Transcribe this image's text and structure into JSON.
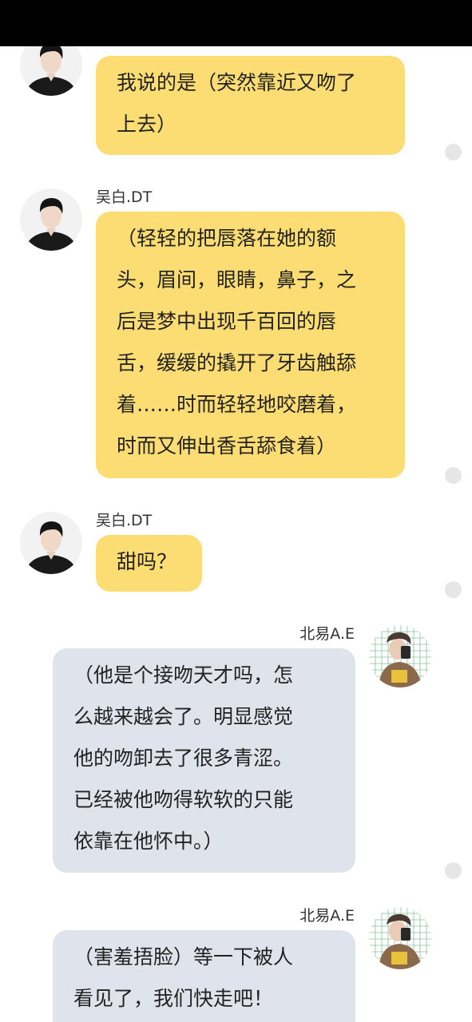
{
  "status_bar": {},
  "messages": [
    {
      "sender": "",
      "text": "我说的是（突然靠近又吻了\n上去）",
      "side": "left",
      "bubble_color": "#fcdd73"
    },
    {
      "sender": "吴白.DT",
      "text": "（轻轻的把唇落在她的额\n头，眉间，眼睛，鼻子，之\n后是梦中出现千百回的唇\n舌，缓缓的撬开了牙齿触舔\n着……时而轻轻地咬磨着，\n时而又伸出香舌舔食着）",
      "side": "left",
      "bubble_color": "#fcdd73"
    },
    {
      "sender": "吴白.DT",
      "text": "甜吗？",
      "side": "left",
      "bubble_color": "#fcdd73"
    },
    {
      "sender": "北易A.E",
      "text": "（他是个接吻天才吗，怎\n么越来越会了。明显感觉\n他的吻卸去了很多青涩。\n已经被他吻得软软的只能\n依靠在他怀中。）",
      "side": "right",
      "bubble_color": "#dfe4ec"
    },
    {
      "sender": "北易A.E",
      "text": "（害羞捂脸）等一下被人\n看见了，我们快走吧！",
      "side": "right",
      "bubble_color": "#dfe4ec"
    }
  ],
  "icons": {
    "left_avatar": "male-avatar-icon",
    "right_avatar": "female-avatar-icon",
    "read_dot": "status-dot-icon"
  }
}
